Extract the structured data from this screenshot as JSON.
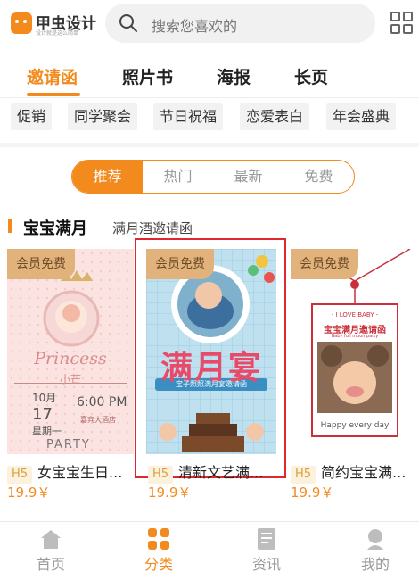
{
  "header": {
    "logo_name": "甲虫设计",
    "logo_slogan": "设计就是这么简单",
    "search_placeholder": "搜索您喜欢的"
  },
  "tabs": [
    {
      "label": "邀请函",
      "active": true
    },
    {
      "label": "照片书",
      "active": false
    },
    {
      "label": "海报",
      "active": false
    },
    {
      "label": "长页",
      "active": false
    }
  ],
  "tags": [
    "促销",
    "同学聚会",
    "节日祝福",
    "恋爱表白",
    "年会盛典"
  ],
  "segment": [
    {
      "label": "推荐",
      "active": true
    },
    {
      "label": "热门",
      "active": false
    },
    {
      "label": "最新",
      "active": false
    },
    {
      "label": "免费",
      "active": false
    }
  ],
  "section": {
    "title": "宝宝满月",
    "subtitle": "满月酒邀请函"
  },
  "cards": [
    {
      "badge": "会员免费",
      "tag": "H5",
      "title": "女宝宝生日...",
      "price": "19.9￥",
      "poster": {
        "name": "Princess",
        "sub": "小芒",
        "date_month": "10月",
        "date_day": "17",
        "weekday": "星期一",
        "time": "6:00 PM",
        "venue": "嘉宾大酒店",
        "footer": "PARTY"
      }
    },
    {
      "badge": "会员免费",
      "tag": "H5",
      "title": "清新文艺满...",
      "price": "19.9￥",
      "poster": {
        "headline": "满月宴",
        "ribbon": "宝子照照满月宴邀请函"
      }
    },
    {
      "badge": "会员免费",
      "tag": "H5",
      "title": "简约宝宝满...",
      "price": "19.9￥",
      "poster": {
        "top": "- I LOVE BABY -",
        "headline": "宝宝满月邀请函",
        "small": "Baby full moon party",
        "footer": "Happy every day"
      }
    }
  ],
  "bottom_nav": [
    {
      "label": "首页",
      "icon": "home-icon",
      "active": false
    },
    {
      "label": "分类",
      "icon": "category-icon",
      "active": true
    },
    {
      "label": "资讯",
      "icon": "news-icon",
      "active": false
    },
    {
      "label": "我的",
      "icon": "profile-icon",
      "active": false
    }
  ],
  "colors": {
    "accent": "#f28a1e",
    "highlight": "#e0272d",
    "badge": "#e2b27c"
  }
}
